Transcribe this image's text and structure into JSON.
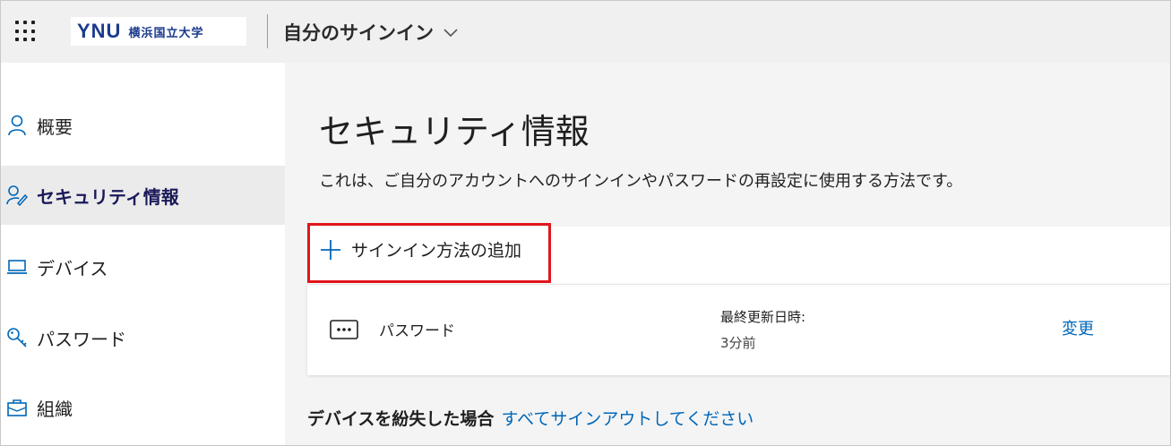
{
  "header": {
    "logo_mark": "YNU",
    "logo_text": "横浜国立大学",
    "app_title": "自分のサインイン"
  },
  "sidebar": {
    "items": [
      {
        "label": "概要",
        "icon": "person-icon"
      },
      {
        "label": "セキュリティ情報",
        "icon": "security-info-icon",
        "active": true
      },
      {
        "label": "デバイス",
        "icon": "laptop-icon"
      },
      {
        "label": "パスワード",
        "icon": "key-icon"
      },
      {
        "label": "組織",
        "icon": "briefcase-icon"
      }
    ]
  },
  "main": {
    "title": "セキュリティ情報",
    "description": "これは、ご自分のアカウントへのサインインやパスワードの再設定に使用する方法です。",
    "add_method_label": "サインイン方法の追加",
    "methods": [
      {
        "name": "パスワード",
        "icon": "password-dots-icon",
        "meta_label": "最終更新日時:",
        "meta_value": "3分前",
        "action_label": "変更"
      }
    ],
    "lost_device_label": "デバイスを紛失した場合",
    "lost_device_link": "すべてサインアウトしてください"
  },
  "colors": {
    "accent": "#0067b8",
    "highlight": "#e0161b",
    "logo": "#1a3a8c"
  }
}
